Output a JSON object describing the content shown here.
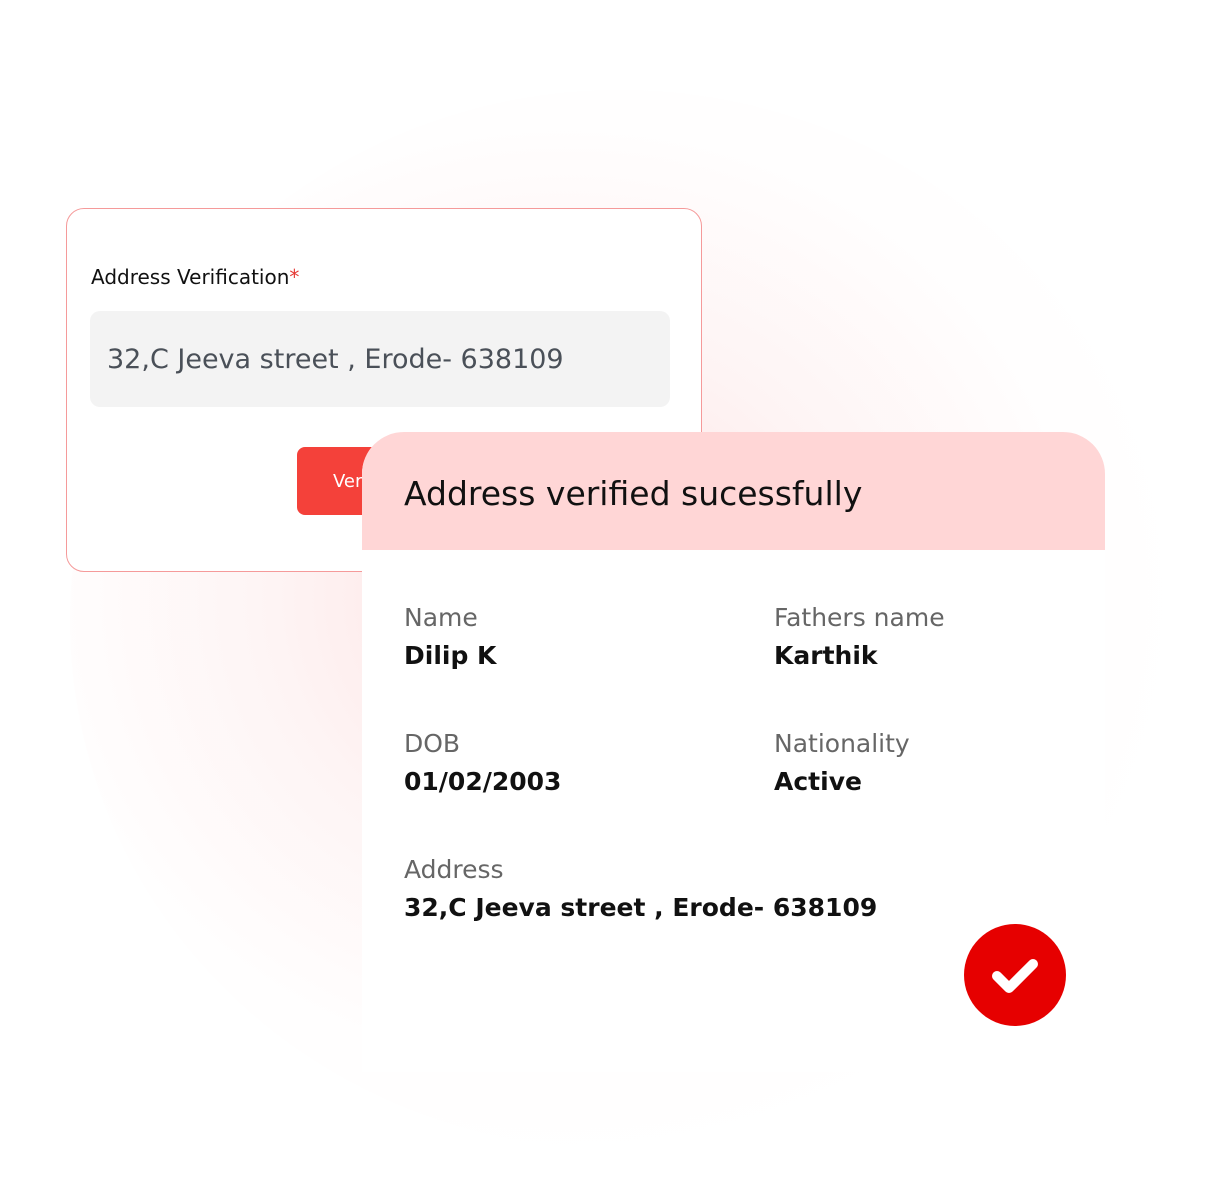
{
  "form": {
    "label": "Address Verification",
    "required_marker": "*",
    "address_value": "32,C Jeeva street , Erode- 638109",
    "verify_button_label": "Verify"
  },
  "result": {
    "title": "Address verified sucessfully",
    "fields": [
      {
        "label": "Name",
        "value": "Dilip K"
      },
      {
        "label": "Fathers name",
        "value": "Karthik"
      },
      {
        "label": "DOB",
        "value": "01/02/2003"
      },
      {
        "label": "Nationality",
        "value": "Active"
      },
      {
        "label": "Address",
        "value": "32,C Jeeva street , Erode- 638109"
      }
    ],
    "status_icon": "check-icon"
  },
  "colors": {
    "accent": "#f4413a",
    "header_bg": "#ffd6d6",
    "success": "#e60000",
    "card_border": "#f59a9a"
  }
}
